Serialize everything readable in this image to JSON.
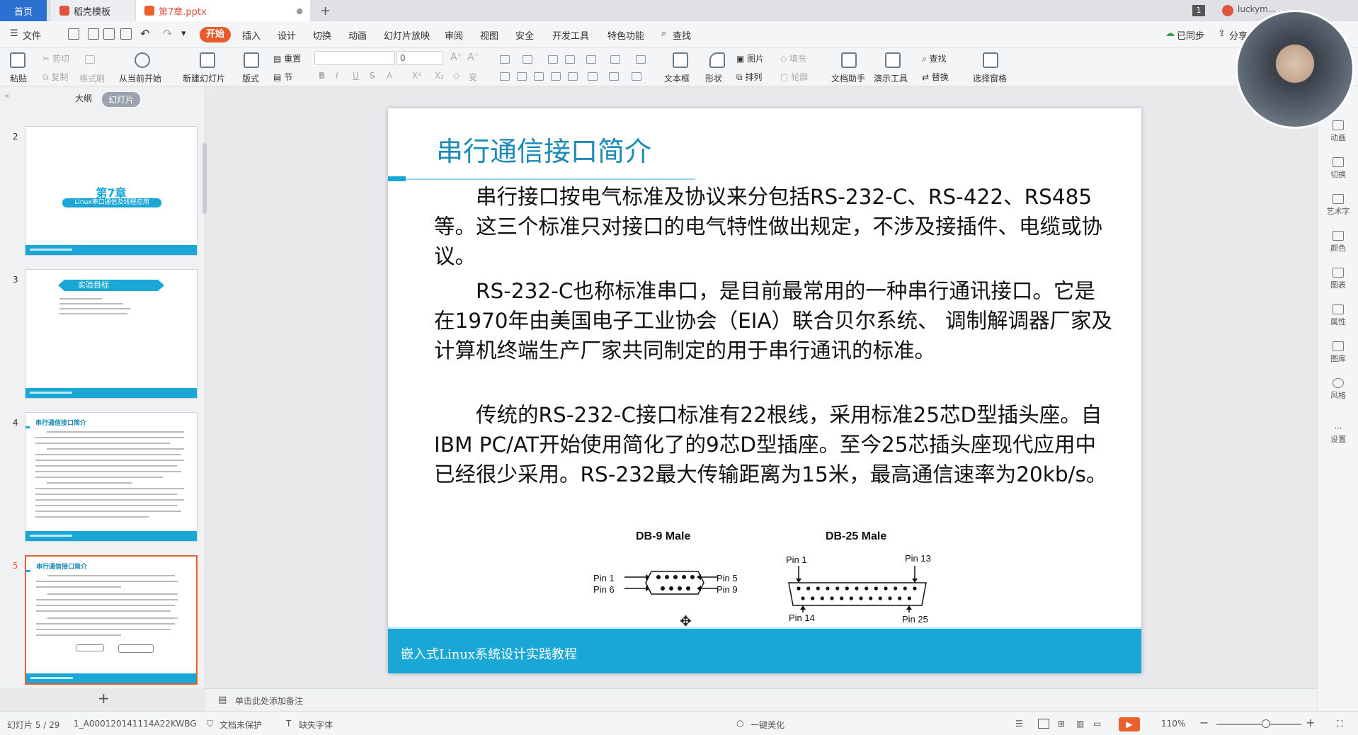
{
  "tabs": {
    "home": "首页",
    "template": "稻壳模板",
    "file": "第7章.pptx",
    "user": "luckym..."
  },
  "menu": {
    "file": "文件",
    "items": [
      "开始",
      "插入",
      "设计",
      "切换",
      "动画",
      "幻灯片放映",
      "审阅",
      "视图",
      "安全",
      "开发工具",
      "特色功能"
    ],
    "search": "查找",
    "sync": "已同步",
    "share": "分享"
  },
  "ribbon": {
    "paste": "粘贴",
    "cut": "剪切",
    "copy": "复制",
    "format_painter": "格式刷",
    "from_current": "从当前开始",
    "new_slide": "新建幻灯片",
    "layout": "版式",
    "reset": "重置",
    "section": "节",
    "font_size": "0",
    "textbox": "文本框",
    "shape": "形状",
    "picture": "图片",
    "fill": "填充",
    "arrange": "排列",
    "outline": "轮廓",
    "doc_helper": "文档助手",
    "present_tools": "演示工具",
    "find": "查找",
    "replace": "替换",
    "select_pane": "选择窗格"
  },
  "left_panel": {
    "outline_tab": "大纲",
    "slides_tab": "幻灯片",
    "slides": [
      {
        "num": "2",
        "title": "第7章",
        "subtitle": "Linux串口通信及线程应用"
      },
      {
        "num": "3",
        "title": "实验目标"
      },
      {
        "num": "4",
        "title": "串行通信接口简介"
      },
      {
        "num": "5",
        "title": "串行通信接口简介"
      }
    ],
    "add": "+"
  },
  "slide": {
    "title": "串行通信接口简介",
    "paragraphs": [
      "串行接口按电气标准及协议来分包括RS-232-C、RS-422、RS485等。这三个标准只对接口的电气特性做出规定，不涉及接插件、电缆或协议。",
      "RS-232-C也称标准串口，是目前最常用的一种串行通讯接口。它是在1970年由美国电子工业协会（EIA）联合贝尔系统、 调制解调器厂家及计算机终端生产厂家共同制定的用于串行通讯的标准。",
      "传统的RS-232-C接口标准有22根线，采用标准25芯D型插头座。自IBM PC/AT开始使用简化了的9芯D型插座。至今25芯插头座现代应用中已经很少采用。RS-232最大传输距离为15米，最高通信速率为20kb/s。"
    ],
    "db9": {
      "label": "DB-9 Male",
      "pin1": "Pin 1",
      "pin6": "Pin 6",
      "pin5": "Pin 5",
      "pin9": "Pin 9"
    },
    "db25": {
      "label": "DB-25 Male",
      "pin1": "Pin 1",
      "pin13": "Pin 13",
      "pin14": "Pin 14",
      "pin25": "Pin 25"
    },
    "footer": "嵌入式Linux系统设计实践教程"
  },
  "notes_placeholder": "单击此处添加备注",
  "right_sidebar": [
    "动画",
    "切换",
    "艺术字",
    "颜色",
    "图表",
    "属性",
    "图库",
    "风格",
    "设置"
  ],
  "status": {
    "slide_counter": "幻灯片 5 / 29",
    "doc_id": "1_A000120141114A22KWBG",
    "protect": "文档未保护",
    "missing_font": "缺失字体",
    "beautify": "一键美化",
    "zoom": "110%"
  },
  "colors": {
    "accent": "#1aa7d6",
    "brand": "#e85a2a",
    "home_tab": "#2b6fd1"
  }
}
